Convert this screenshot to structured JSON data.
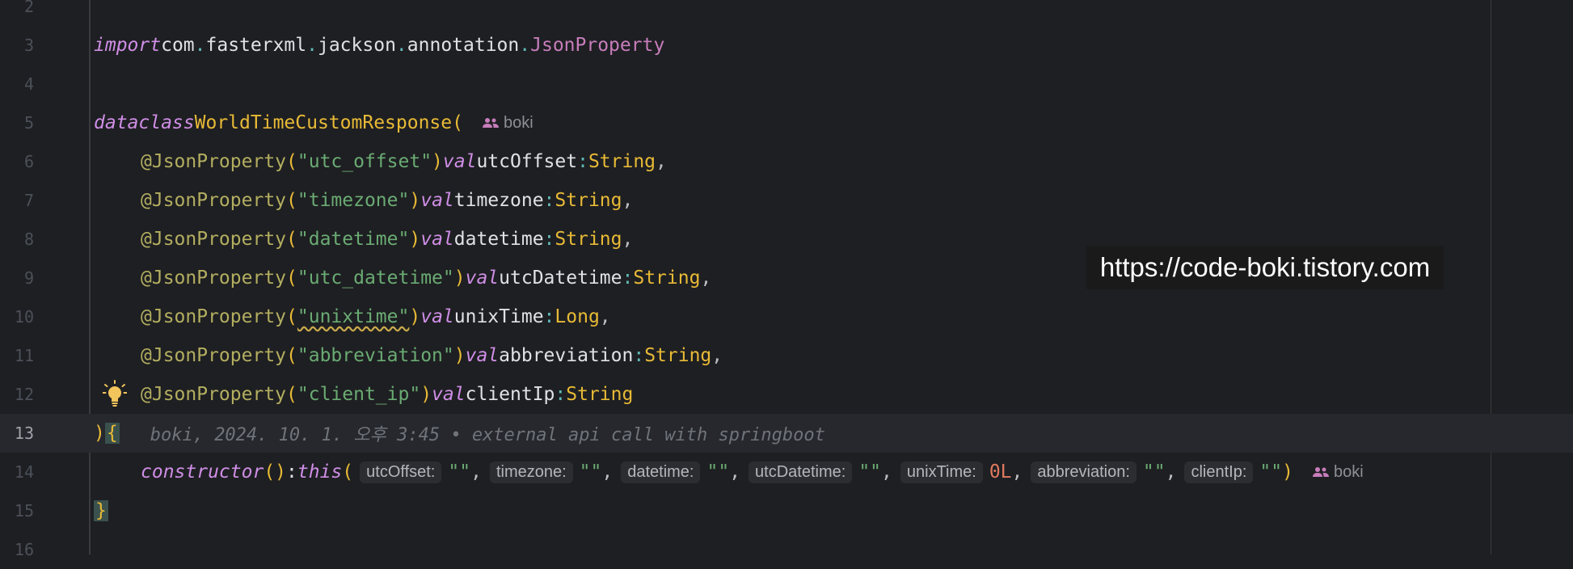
{
  "editor": {
    "lines": [
      {
        "number": "2"
      },
      {
        "number": "3"
      },
      {
        "number": "4"
      },
      {
        "number": "5"
      },
      {
        "number": "6"
      },
      {
        "number": "7"
      },
      {
        "number": "8"
      },
      {
        "number": "9"
      },
      {
        "number": "10"
      },
      {
        "number": "11"
      },
      {
        "number": "12"
      },
      {
        "number": "13"
      },
      {
        "number": "14"
      },
      {
        "number": "15"
      },
      {
        "number": "16"
      }
    ],
    "current_line": "13",
    "tokens": {
      "import_kw": "import",
      "import_pkg_1": "com",
      "import_pkg_2": "fasterxml",
      "import_pkg_3": "jackson",
      "import_pkg_4": "annotation",
      "import_cls": "JsonProperty",
      "data_kw": "data",
      "class_kw": "class",
      "class_name": "WorldTimeCustomResponse(",
      "author": "boki",
      "annotation": "@JsonProperty",
      "val_kw": "val",
      "type_string": "String",
      "type_long": "Long",
      "constructor_kw": "constructor",
      "this_kw": "this",
      "close_paren": ")",
      "open_brace": "{",
      "close_brace": "}"
    },
    "properties": [
      {
        "json": "\"utc_offset\"",
        "name": "utcOffset",
        "type": "String",
        "sep": ","
      },
      {
        "json": "\"timezone\"",
        "name": "timezone",
        "type": "String",
        "sep": ","
      },
      {
        "json": "\"datetime\"",
        "name": "datetime",
        "type": "String",
        "sep": ","
      },
      {
        "json": "\"utc_datetime\"",
        "name": "utcDatetime",
        "type": "String",
        "sep": ","
      },
      {
        "json": "\"unixtime\"",
        "name": "unixTime",
        "type": "Long",
        "sep": ","
      },
      {
        "json": "\"abbreviation\"",
        "name": "abbreviation",
        "type": "String",
        "sep": ","
      },
      {
        "json": "\"client_ip\"",
        "name": "clientIp",
        "type": "String",
        "sep": ""
      }
    ],
    "blame": "boki, 2024. 10. 1. 오후 3:45 • external api call with springboot",
    "constructor_args": [
      {
        "hint": "utcOffset:",
        "value": "\"\"",
        "sep": ","
      },
      {
        "hint": "timezone:",
        "value": "\"\"",
        "sep": ","
      },
      {
        "hint": "datetime:",
        "value": "\"\"",
        "sep": ","
      },
      {
        "hint": "utcDatetime:",
        "value": "\"\"",
        "sep": ","
      },
      {
        "hint": "unixTime:",
        "value": "0L",
        "sep": ","
      },
      {
        "hint": "abbreviation:",
        "value": "\"\"",
        "sep": ","
      },
      {
        "hint": "clientIp:",
        "value": "\"\"",
        "sep": ""
      }
    ]
  },
  "watermark": "https://code-boki.tistory.com",
  "colors": {
    "background": "#1e1f22",
    "current_line": "#26282e",
    "keyword": "#cf8ee6",
    "annotation": "#b3ae60",
    "string": "#6aab73",
    "type": "#e8ba36",
    "number": "#2aacb8"
  },
  "icons": {
    "bulb": "lightbulb-icon",
    "author": "people-icon"
  }
}
